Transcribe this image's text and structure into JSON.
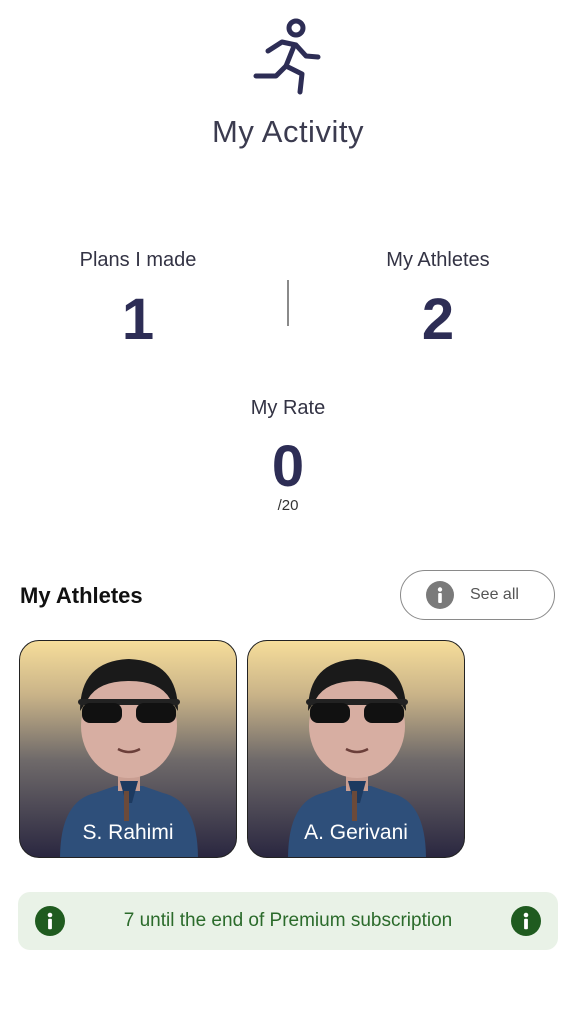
{
  "header": {
    "icon": "running-person-icon",
    "title": "My Activity"
  },
  "stats": {
    "plans": {
      "label": "Plans I made",
      "value": "1"
    },
    "athletes": {
      "label": "My Athletes",
      "value": "2"
    },
    "rate": {
      "label": "My Rate",
      "value": "0",
      "suffix": "/20"
    }
  },
  "athletes_section": {
    "title": "My Athletes",
    "see_all_label": "See all",
    "see_all_icon": "info-icon",
    "items": [
      {
        "name": "S. Rahimi"
      },
      {
        "name": "A. Gerivani"
      }
    ]
  },
  "notice": {
    "text": "7 until the end of Premium subscription",
    "icon": "info-icon",
    "color": "#1f5b1f"
  }
}
